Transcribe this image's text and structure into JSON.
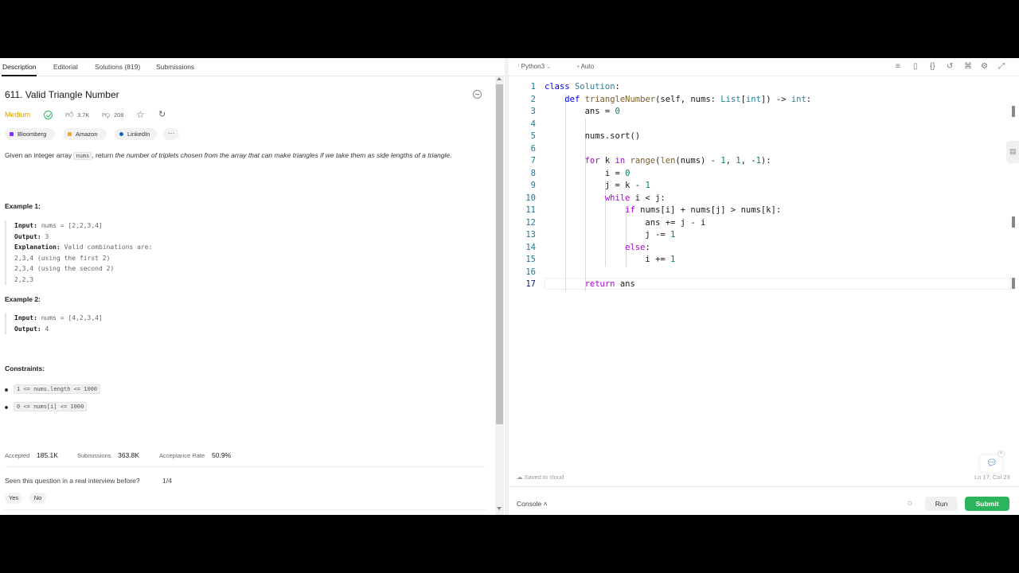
{
  "tabs": [
    "Description",
    "Editorial",
    "Solutions (819)",
    "Submissions"
  ],
  "problem": {
    "title": "611. Valid Triangle Number",
    "difficulty": "Medium",
    "likes": "3.7K",
    "dislikes": "208",
    "companies": [
      "Bloomberg",
      "Amazon",
      "LinkedIn"
    ],
    "companies_more": "···",
    "desc_1": "Given an integer array ",
    "desc_code": "nums",
    "desc_2": ", return ",
    "desc_em": "the number of triplets chosen from the array that can make triangles if we take them as side lengths of a triangle",
    "desc_3": "."
  },
  "example1": {
    "title": "Example 1:",
    "input_label": "Input:",
    "input": " nums = [2,2,3,4]",
    "output_label": "Output:",
    "output": " 3",
    "explanation_label": "Explanation:",
    "explanation": " Valid combinations are:",
    "lines": [
      "2,3,4 (using the first 2)",
      "2,3,4 (using the second 2)",
      "2,2,3"
    ]
  },
  "example2": {
    "title": "Example 2:",
    "input_label": "Input:",
    "input": " nums = [4,2,3,4]",
    "output_label": "Output:",
    "output": " 4"
  },
  "constraints": {
    "title": "Constraints:",
    "items": [
      "1 <= nums.length <= 1000",
      "0 <= nums[i] <= 1000"
    ]
  },
  "stats": {
    "accepted_label": "Accepted",
    "accepted": "185.1K",
    "submissions_label": "Submissions",
    "submissions": "363.8K",
    "rate_label": "Acceptance Rate",
    "rate": "50.9%"
  },
  "interview": {
    "question": "Seen this question in a real interview before?",
    "fraction": "1/4",
    "yes": "Yes",
    "no": "No"
  },
  "editor": {
    "language": "Python3",
    "mode": "Auto",
    "saved": "Saved to cloud",
    "cursor": "Ln 17, Col 23",
    "line_numbers": [
      "1",
      "2",
      "3",
      "4",
      "5",
      "6",
      "7",
      "8",
      "9",
      "10",
      "11",
      "12",
      "13",
      "14",
      "15",
      "16",
      "17"
    ]
  },
  "console": {
    "label": "Console",
    "run": "Run",
    "submit": "Submit"
  },
  "colors": {
    "medium": "#e0a100",
    "accent_green": "#2db55d",
    "keyword": "#af00db",
    "type": "#267f99"
  },
  "icons": {
    "solved": "check-circle-icon",
    "like": "thumbs-up-icon",
    "dislike": "thumbs-down-icon",
    "favorite": "star-icon",
    "share": "share-icon",
    "timer": "clock-icon",
    "chat": "chat-icon"
  }
}
